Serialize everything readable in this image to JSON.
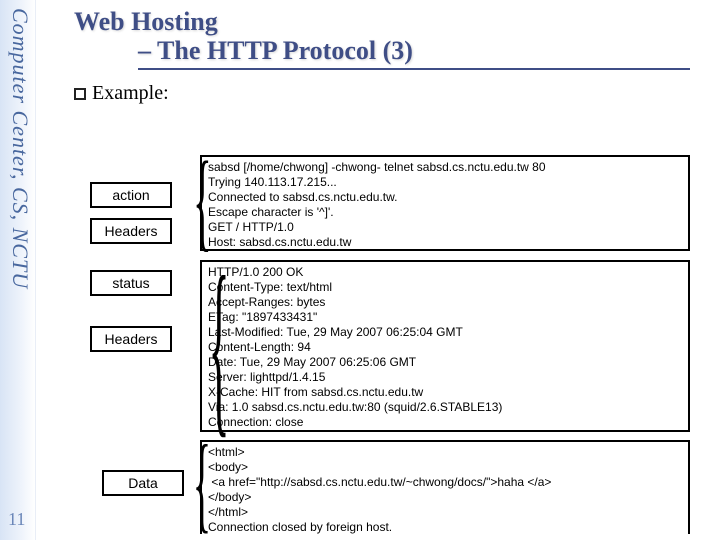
{
  "sidebar": {
    "text": "Computer Center, CS, NCTU"
  },
  "page_number": "11",
  "title_line1": "Web Hosting",
  "title_line2": "– The HTTP Protocol (3)",
  "example_label": "Example:",
  "labels": {
    "action": "action",
    "headers1": "Headers",
    "status": "status",
    "headers2": "Headers",
    "data": "Data"
  },
  "box1": "sabsd [/home/chwong] -chwong- telnet sabsd.cs.nctu.edu.tw 80\nTrying 140.113.17.215...\nConnected to sabsd.cs.nctu.edu.tw.\nEscape character is '^]'.\nGET / HTTP/1.0\nHost: sabsd.cs.nctu.edu.tw",
  "box2": "HTTP/1.0 200 OK\nContent-Type: text/html\nAccept-Ranges: bytes\nETag: \"1897433431\"\nLast-Modified: Tue, 29 May 2007 06:25:04 GMT\nContent-Length: 94\nDate: Tue, 29 May 2007 06:25:06 GMT\nServer: lighttpd/1.4.15\nX-Cache: HIT from sabsd.cs.nctu.edu.tw\nVia: 1.0 sabsd.cs.nctu.edu.tw:80 (squid/2.6.STABLE13)\nConnection: close",
  "box3": "<html>\n<body>\n <a href=\"http://sabsd.cs.nctu.edu.tw/~chwong/docs/\">haha </a>\n</body>\n</html>\nConnection closed by foreign host."
}
